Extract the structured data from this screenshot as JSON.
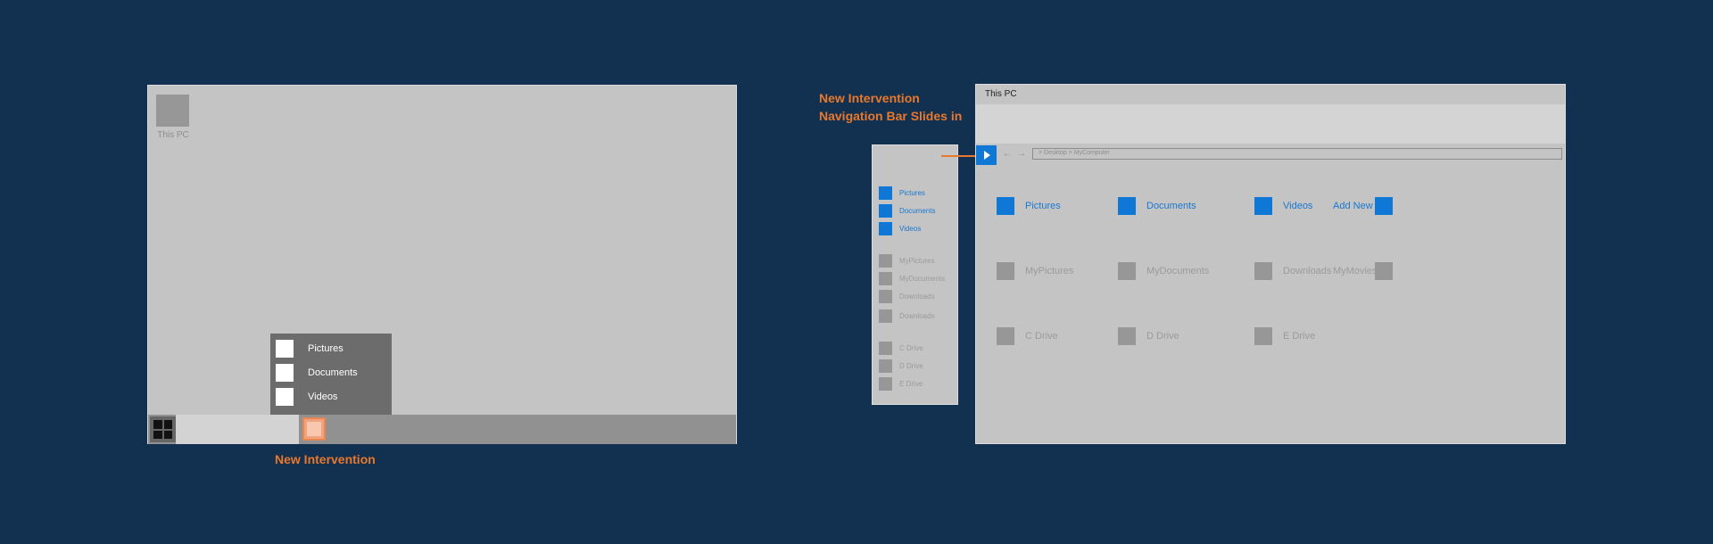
{
  "colors": {
    "background": "#12304f",
    "accent_blue": "#0f78d6",
    "callout_orange": "#e8782d",
    "highlight_peach": "#f0a37e"
  },
  "desktop": {
    "this_pc_label": "This PC",
    "jumplist": {
      "items": [
        "Pictures",
        "Documents",
        "Videos"
      ]
    },
    "callout": "New Intervention"
  },
  "explorer": {
    "callout_line1": "New Intervention",
    "callout_line2": "Navigation Bar Slides in",
    "title": "This PC",
    "nav": {
      "back_icon": "←",
      "forward_icon": "→",
      "address": "> Desktop > MyComputer"
    },
    "sidebar": {
      "quick": [
        "Pictures",
        "Documents",
        "Videos"
      ],
      "folders": [
        "MyPictures",
        "MyDocuments",
        "Downloads",
        "Downloads"
      ],
      "drives": [
        "C Drive",
        "D Drive",
        "E Drive"
      ]
    },
    "quick": [
      "Pictures",
      "Documents",
      "Videos"
    ],
    "add_new": "Add New",
    "folders": [
      "MyPictures",
      "MyDocuments",
      "Downloads",
      "MyMovies"
    ],
    "drives": [
      "C Drive",
      "D Drive",
      "E Drive"
    ]
  }
}
